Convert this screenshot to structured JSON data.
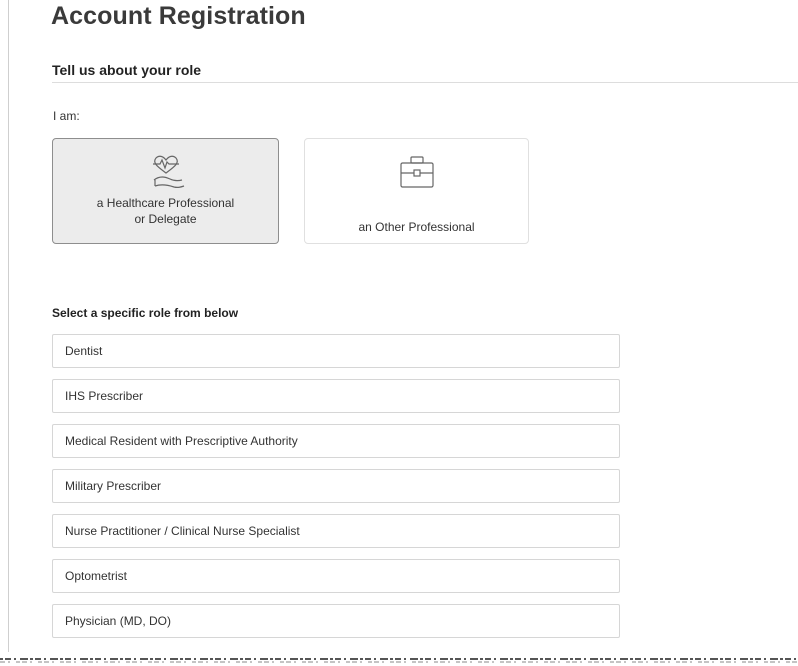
{
  "page": {
    "title": "Account Registration"
  },
  "role_section": {
    "heading": "Tell us about your role",
    "i_am_label": "I am:",
    "cards": [
      {
        "label": "a Healthcare Professional\nor Delegate",
        "icon": "heart-hand-icon",
        "selected": true
      },
      {
        "label": "an Other Professional",
        "icon": "briefcase-icon",
        "selected": false
      }
    ]
  },
  "specific_roles": {
    "heading": "Select a specific role from below",
    "options": [
      "Dentist",
      "IHS Prescriber",
      "Medical Resident with Prescriptive Authority",
      "Military Prescriber",
      "Nurse Practitioner / Clinical Nurse Specialist",
      "Optometrist",
      "Physician (MD, DO)"
    ]
  },
  "colors": {
    "selected_card_bg": "#ececec",
    "selected_card_border": "#8e8e8e",
    "card_border": "#e0e0e0",
    "option_border": "#d6d6d6",
    "title_text": "#3a3a3a"
  }
}
